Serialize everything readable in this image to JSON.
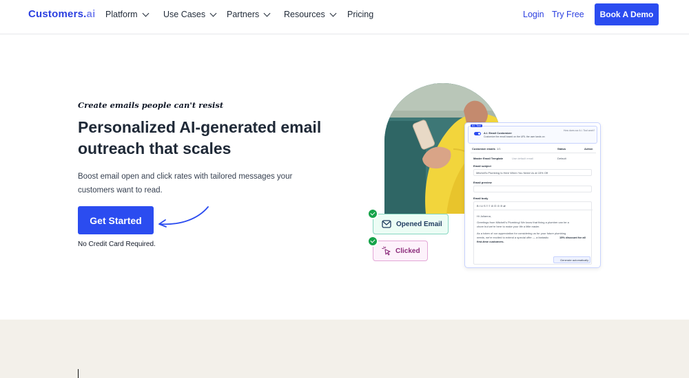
{
  "nav": {
    "logo_main": "Customers.",
    "logo_ai": "ai",
    "items": [
      {
        "label": "Platform",
        "has_dropdown": true
      },
      {
        "label": "Use Cases",
        "has_dropdown": true
      },
      {
        "label": "Partners",
        "has_dropdown": true
      },
      {
        "label": "Resources",
        "has_dropdown": true
      },
      {
        "label": "Pricing",
        "has_dropdown": false
      }
    ],
    "login": "Login",
    "try_free": "Try Free",
    "demo": "Book A Demo"
  },
  "hero": {
    "tagline": "Create emails people can't resist",
    "headline": "Personalized AI-generated email outreach that scales",
    "sub": "Boost email open and click rates with tailored messages your customers want to read.",
    "cta": "Get Started",
    "no_cc": "No Credit Card Required."
  },
  "illustration": {
    "badge_opened": "Opened Email",
    "badge_clicked": "Clicked",
    "panel": {
      "tag": "A.I. Tool",
      "toggle_title": "A.I. Email Customizer",
      "toggle_desc": "Customize the email based on the URL the user lands on",
      "howto": "How does our A.I. Tool work?",
      "col_emails": "Customize emails",
      "col_emails_count": "1/1",
      "col_status": "Status",
      "col_action": "Action",
      "template_name": "Master Email Template",
      "template_note": "Use default email",
      "template_status": "Default",
      "subject_label": "Email subject",
      "subject_value": "Mitchell's Plumbing Is Here When You Need Us at 15% Off",
      "preview_label": "Email preview",
      "body_label": "Email body",
      "toolbar": "B  I  U  S     ≡  ≡     ⊘  ⊡  ⊙  ⊖     ⇄",
      "body_line1": "Hi Julianna,",
      "body_line2": "Greetings from Mitchell's Plumbing! We know that fixing a plumber can be a",
      "body_line3": "chore but we're here to make your life a little easier.",
      "body_line4": "As a token of our appreciation for considering us for your future plumbing",
      "body_line5": "needs, we're excited to extend a special offer — a fantastic",
      "body_line5_bold": "15% discount for all",
      "body_line6": "first-time customers.",
      "generate": "Generate automatically"
    }
  },
  "colors": {
    "brand": "#2b4cf0",
    "bottom_bg": "#f3f0ea"
  }
}
